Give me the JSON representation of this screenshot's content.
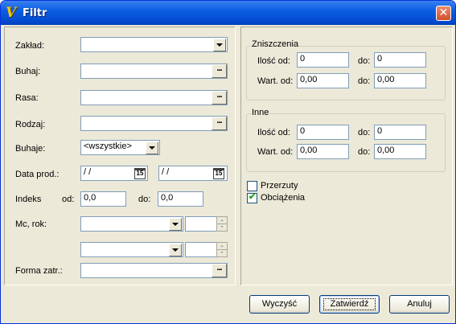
{
  "window": {
    "title": "Filtr",
    "app_icon_glyph": "V",
    "close_glyph": "✕"
  },
  "left": {
    "zaklad": {
      "label": "Zakład:",
      "value": ""
    },
    "buhaj": {
      "label": "Buhaj:",
      "value": "",
      "button": "..."
    },
    "rasa": {
      "label": "Rasa:",
      "value": "",
      "button": "..."
    },
    "rodzaj": {
      "label": "Rodzaj:",
      "value": "",
      "button": "..."
    },
    "buhaje": {
      "label": "Buhaje:",
      "selected": "<wszystkie>"
    },
    "data_prod": {
      "label": "Data prod.:",
      "from": " / /",
      "to": " / /",
      "calendar_glyph": "15"
    },
    "indeks": {
      "label": "Indeks",
      "od_label": "od:",
      "od_value": "0,0",
      "do_label": "do:",
      "do_value": "0,0"
    },
    "mc_rok": {
      "label": "Mc, rok:",
      "row1_month": "",
      "row1_year": "",
      "row2_month": "",
      "row2_year": ""
    },
    "forma_zatr": {
      "label": "Forma zatr.:",
      "value": "",
      "button": "..."
    }
  },
  "right": {
    "zniszczenia": {
      "title": "Zniszczenia",
      "ilosc_label": "Ilość od:",
      "ilosc_od": "0",
      "ilosc_do_label": "do:",
      "ilosc_do": "0",
      "wart_label": "Wart. od:",
      "wart_od": "0,00",
      "wart_do_label": "do:",
      "wart_do": "0,00"
    },
    "inne": {
      "title": "Inne",
      "ilosc_label": "Ilość od:",
      "ilosc_od": "0",
      "ilosc_do_label": "do:",
      "ilosc_do": "0",
      "wart_label": "Wart. od:",
      "wart_od": "0,00",
      "wart_do_label": "do:",
      "wart_do": "0,00"
    },
    "przerzuty": {
      "label": "Przerzuty",
      "checked": false
    },
    "obciazenia": {
      "label": "Obciążenia",
      "checked": true,
      "check_glyph": "✔"
    }
  },
  "buttons": {
    "clear": "Wyczyść",
    "confirm": "Zatwierdź",
    "cancel": "Anuluj"
  },
  "colors": {
    "titlebar": "#0a5fe0",
    "face": "#ece9d8",
    "field_border": "#7f9db9",
    "close": "#d24f2c"
  }
}
